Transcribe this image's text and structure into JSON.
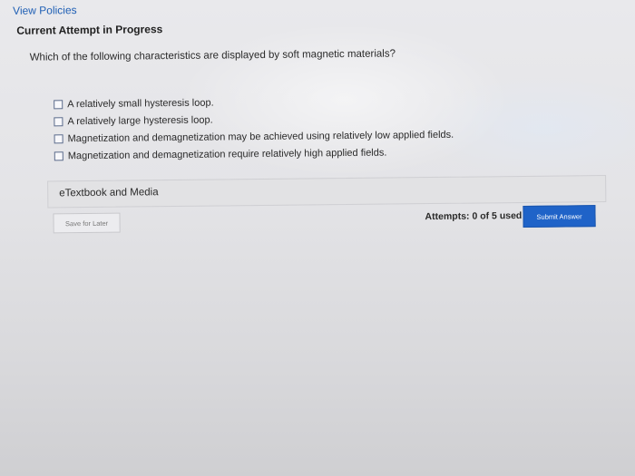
{
  "header": {
    "view_policies": "View Policies",
    "attempt_status": "Current Attempt in Progress"
  },
  "question": {
    "text": "Which of the following characteristics are displayed by soft magnetic materials?",
    "options": [
      {
        "label": "A relatively small hysteresis loop.",
        "checked": false
      },
      {
        "label": "A relatively large hysteresis loop.",
        "checked": false
      },
      {
        "label": "Magnetization and demagnetization may be achieved using relatively low applied fields.",
        "checked": false
      },
      {
        "label": "Magnetization and demagnetization require relatively high applied fields.",
        "checked": false
      }
    ]
  },
  "resources": {
    "etextbook_label": "eTextbook and Media"
  },
  "footer": {
    "save_label": "Save for Later",
    "attempts_text": "Attempts: 0 of 5 used",
    "submit_label": "Submit Answer"
  },
  "colors": {
    "link": "#1f5fb5",
    "submit_bg": "#1f63c8"
  }
}
